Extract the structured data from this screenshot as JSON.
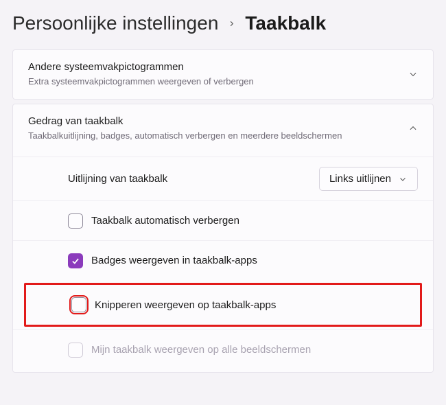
{
  "breadcrumb": {
    "parent": "Persoonlijke instellingen",
    "current": "Taakbalk"
  },
  "panels": {
    "other_icons": {
      "title": "Andere systeemvakpictogrammen",
      "subtitle": "Extra systeemvakpictogrammen weergeven of verbergen"
    },
    "behavior": {
      "title": "Gedrag van taakbalk",
      "subtitle": "Taakbalkuitlijning, badges, automatisch verbergen en meerdere beeldschermen"
    }
  },
  "settings": {
    "alignment": {
      "label": "Uitlijning van taakbalk",
      "value": "Links uitlijnen"
    },
    "auto_hide": {
      "label": "Taakbalk automatisch verbergen"
    },
    "badges": {
      "label": "Badges weergeven in taakbalk-apps"
    },
    "flashing": {
      "label": "Knipperen weergeven op taakbalk-apps"
    },
    "all_displays": {
      "label": "Mijn taakbalk weergeven op alle beeldschermen"
    }
  }
}
